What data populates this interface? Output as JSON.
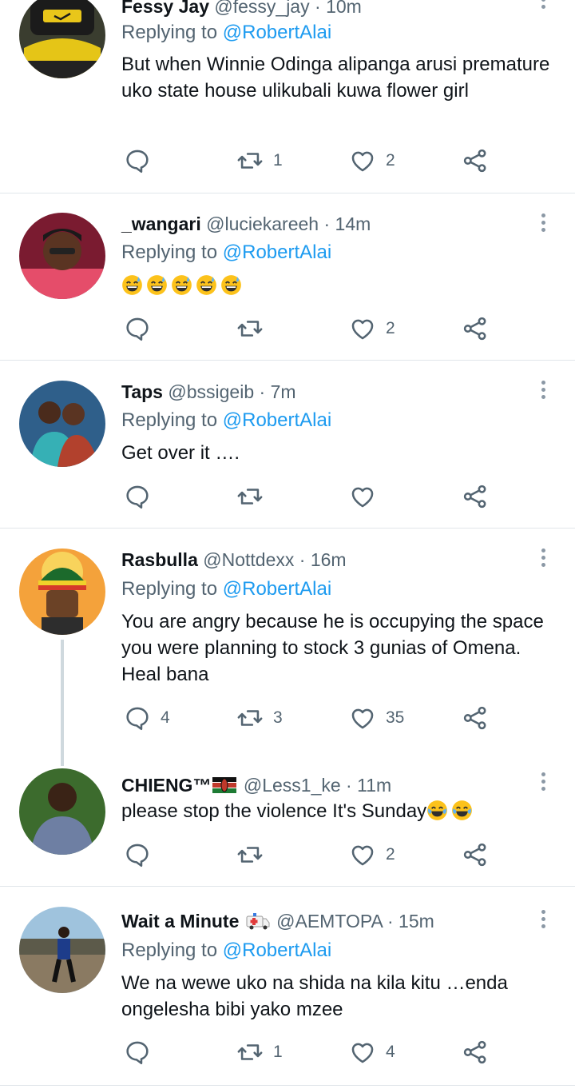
{
  "reply_prefix": "Replying to ",
  "tweets": [
    {
      "name": "Fessy Jay",
      "handle": "@fessy_jay",
      "time": "10m",
      "reply_to": "@RobertAlai",
      "text": "But when Winnie Odinga alipanga arusi premature uko state house ulikubali kuwa flower girl",
      "replies": "",
      "retweets": "1",
      "likes": "2"
    },
    {
      "name": "_wangari",
      "handle": "@luciekareeh",
      "time": "14m",
      "reply_to": "@RobertAlai",
      "text": "",
      "replies": "",
      "retweets": "",
      "likes": "2"
    },
    {
      "name": "Taps",
      "handle": "@bssigeib",
      "time": "7m",
      "reply_to": "@RobertAlai",
      "text": "Get over it ….",
      "replies": "",
      "retweets": "",
      "likes": ""
    },
    {
      "name": "Rasbulla",
      "handle": "@Nottdexx",
      "time": "16m",
      "reply_to": "@RobertAlai",
      "text": "You are angry  because he is occupying the space you were planning to stock  3 gunias of Omena. Heal bana",
      "replies": "4",
      "retweets": "3",
      "likes": "35"
    },
    {
      "name": "CHIENG™",
      "handle": "@Less1_ke",
      "time": "11m",
      "text": "please stop the violence It's Sunday",
      "replies": "",
      "retweets": "",
      "likes": "2"
    },
    {
      "name": "Wait a Minute",
      "handle": "@AEMTOPA",
      "time": "15m",
      "reply_to": "@RobertAlai",
      "text": "We na wewe uko na shida na kila kitu …enda ongelesha bibi yako mzee",
      "replies": "",
      "retweets": "1",
      "likes": "4"
    }
  ],
  "colors": {
    "link": "#1d9bf0",
    "muted": "#536471",
    "divider": "#e1e6ea"
  },
  "icons": [
    "reply-icon",
    "retweet-icon",
    "like-icon",
    "share-icon",
    "more-icon",
    "emoji-sweat-smile",
    "emoji-tears-of-joy",
    "kenya-flag",
    "ambulance-emoji"
  ]
}
